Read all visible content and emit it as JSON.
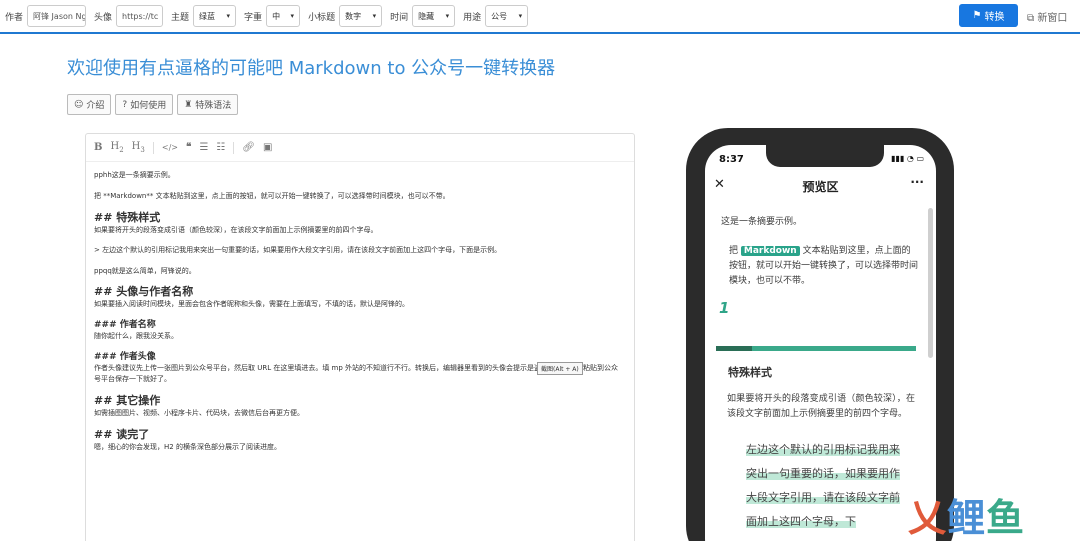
{
  "toolbar": {
    "author_label": "作者",
    "author_value": "阿锋 Jason Ng",
    "avatar_label": "头像",
    "avatar_value": "https://tc",
    "theme_label": "主题",
    "theme_value": "绿蓝",
    "fontsize_label": "字重",
    "fontsize_value": "中",
    "subtitle_label": "小标题",
    "subtitle_value": "数字",
    "time_label": "时间",
    "time_value": "隐藏",
    "usage_label": "用途",
    "usage_value": "公号",
    "convert_label": "转换",
    "newwindow_label": "新窗口",
    "accent_color": "#1877e0"
  },
  "page": {
    "title": "欢迎使用有点逼格的可能吧 Markdown to 公众号一键转换器",
    "tabs": [
      {
        "icon": "smile-icon",
        "label": "介绍"
      },
      {
        "icon": "help-icon",
        "label": "如何使用"
      },
      {
        "icon": "syntax-icon",
        "label": "特殊语法"
      }
    ]
  },
  "editor": {
    "lines": {
      "summary": "pphh这是一条摘要示例。",
      "intro": "把 **Markdown** 文本粘贴到这里，点上面的按钮，就可以开始一键转换了，可以选择带时间模块，也可以不带。",
      "h_special": "## 特殊样式",
      "special_desc": "如果要将开头的段落变成引语（颜色较深），在该段文字前面加上示例摘要里的前四个字母。",
      "quote_desc": "> 左边这个默认的引用标记我用来突出一句重要的话，如果要用作大段文字引用，请在该段文字前面加上这四个字母，下面是示例。",
      "ppqq": "ppqq就是这么简单，阿锋说的。",
      "h_avatar": "## 头像与作者名称",
      "avatar_desc": "如果要插入阅读时间模块，里面会包含作者昵称和头像，需要在上面填写，不填的话，默认是阿锋的。",
      "h_author": "### 作者名称",
      "author_desc": "随你起什么，跟我没关系。",
      "h_avatar2": "### 作者头像",
      "avatar2_desc": "作者头像建议先上传一张图片到公众号平台，然后取 URL 在这里填进去。填 mp 外站的不知道行不行。转换后，编辑器里看到的头像会提示是盗链，没关系，粘贴到公众号平台保存一下就好了。",
      "h_other": "## 其它操作",
      "other_desc": "如需插图图片、视频、小程序卡片、代码块，去微信后台再更方便。",
      "h_done": "## 读完了",
      "done_desc": "嗯，细心的你会发现，H2 的横条深色部分展示了阅读进度。"
    },
    "tooltip": "截图(Alt + A)"
  },
  "preview": {
    "time": "8:37",
    "title": "预览区",
    "summary": "这是一条摘要示例。",
    "para_pre": "把",
    "markdown_tag": "Markdown",
    "para_post": "文本粘贴到这里，点上面的按钮，就可以开始一键转换了，可以选择带时间模块，也可以不带。",
    "number": "1",
    "h2": "特殊样式",
    "desc": "如果要将开头的段落变成引语（颜色较深），在该段文字前面加上示例摘要里的前四个字母。",
    "quote": "左边这个默认的引用标记我用来突出一句重要的话，如果要用作大段文字引用，请在该段文字前面加上这四个字母，下",
    "progress": 0.18,
    "accent_color": "#3aa98a"
  },
  "watermark": "鲤鱼"
}
